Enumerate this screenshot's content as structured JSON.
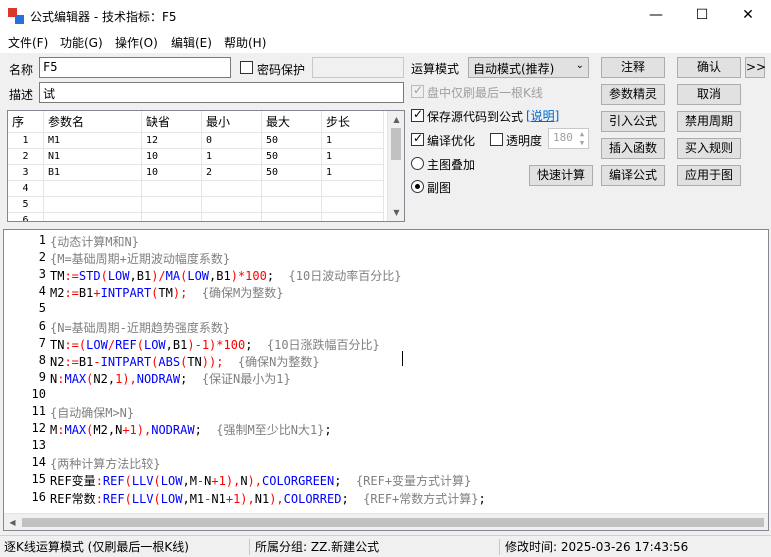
{
  "window": {
    "title": "公式编辑器 - 技术指标：F5",
    "min_glyph": "—",
    "max_glyph": "☐",
    "close_glyph": "✕"
  },
  "menu": [
    "文件(F)",
    "功能(G)",
    "操作(O)",
    "编辑(E)",
    "帮助(H)"
  ],
  "form": {
    "name_label": "名称",
    "name_value": "F5",
    "password_label": "密码保护",
    "desc_label": "描述",
    "desc_value": "试",
    "mode_label": "运算模式",
    "mode_value": "自动模式(推荐)",
    "last_kline_label": "盘中仅刷最后一根K线",
    "save_source_label": "保存源代码到公式",
    "explain_link": "[说明]",
    "compile_opt_label": "编译优化",
    "transparency_label": "透明度",
    "transparency_value": "180",
    "main_overlay_label": "主图叠加",
    "sub_chart_label": "副图"
  },
  "buttons": {
    "annotate": "注释",
    "confirm": "确认",
    "expand": ">>",
    "param_wizard": "参数精灵",
    "cancel": "取消",
    "import_formula": "引入公式",
    "disable_period": "禁用周期",
    "insert_function": "插入函数",
    "buy_rule": "买入规则",
    "quick_calc": "快速计算",
    "compile_formula": "编译公式",
    "apply_chart": "应用于图"
  },
  "param_table": {
    "headers": [
      "序",
      "参数名",
      "缺省",
      "最小",
      "最大",
      "步长"
    ],
    "rows": [
      [
        "1",
        "M1",
        "12",
        "0",
        "50",
        "1"
      ],
      [
        "2",
        "N1",
        "10",
        "1",
        "50",
        "1"
      ],
      [
        "3",
        "B1",
        "10",
        "2",
        "50",
        "1"
      ],
      [
        "4",
        "",
        "",
        "",
        "",
        ""
      ],
      [
        "5",
        "",
        "",
        "",
        "",
        ""
      ],
      [
        "6",
        "",
        "",
        "",
        "",
        ""
      ]
    ]
  },
  "colors": {
    "comment": "#808080",
    "function": "#0000ff",
    "operator": "#ff0000",
    "number": "#ff0000",
    "identifier": "#000000",
    "constant": "#0000ff"
  },
  "code_lines": [
    {
      "n": "1",
      "tokens": [
        {
          "t": "{动态计算M和N}",
          "c": "comment"
        }
      ]
    },
    {
      "n": "2",
      "tokens": [
        {
          "t": "{M=基础周期+近期波动幅度系数}",
          "c": "comment"
        }
      ]
    },
    {
      "n": "3",
      "tokens": [
        {
          "t": "TM",
          "c": "identifier"
        },
        {
          "t": ":=",
          "c": "operator"
        },
        {
          "t": "STD",
          "c": "function"
        },
        {
          "t": "(",
          "c": "operator"
        },
        {
          "t": "LOW",
          "c": "function"
        },
        {
          "t": ",",
          "c": "identifier"
        },
        {
          "t": "B1",
          "c": "identifier"
        },
        {
          "t": ")/",
          "c": "operator"
        },
        {
          "t": "MA",
          "c": "function"
        },
        {
          "t": "(",
          "c": "operator"
        },
        {
          "t": "LOW",
          "c": "function"
        },
        {
          "t": ",",
          "c": "identifier"
        },
        {
          "t": "B1",
          "c": "identifier"
        },
        {
          "t": ")*",
          "c": "operator"
        },
        {
          "t": "100",
          "c": "number"
        },
        {
          "t": ";  ",
          "c": "identifier"
        },
        {
          "t": "{10日波动率百分比}",
          "c": "comment"
        }
      ]
    },
    {
      "n": "4",
      "tokens": [
        {
          "t": "M2",
          "c": "identifier"
        },
        {
          "t": ":=",
          "c": "operator"
        },
        {
          "t": "B1",
          "c": "identifier"
        },
        {
          "t": "+",
          "c": "operator"
        },
        {
          "t": "INTPART",
          "c": "function"
        },
        {
          "t": "(",
          "c": "operator"
        },
        {
          "t": "TM",
          "c": "identifier"
        },
        {
          "t": ");  ",
          "c": "operator"
        },
        {
          "t": "{确保M为整数}",
          "c": "comment"
        }
      ]
    },
    {
      "n": "5",
      "tokens": []
    },
    {
      "n": "6",
      "tokens": [
        {
          "t": "{N=基础周期-近期趋势强度系数}",
          "c": "comment"
        }
      ]
    },
    {
      "n": "7",
      "tokens": [
        {
          "t": "TN",
          "c": "identifier"
        },
        {
          "t": ":=(",
          "c": "operator"
        },
        {
          "t": "LOW",
          "c": "function"
        },
        {
          "t": "/",
          "c": "operator"
        },
        {
          "t": "REF",
          "c": "function"
        },
        {
          "t": "(",
          "c": "operator"
        },
        {
          "t": "LOW",
          "c": "function"
        },
        {
          "t": ",",
          "c": "identifier"
        },
        {
          "t": "B1",
          "c": "identifier"
        },
        {
          "t": ")-",
          "c": "operator"
        },
        {
          "t": "1",
          "c": "number"
        },
        {
          "t": ")*",
          "c": "operator"
        },
        {
          "t": "100",
          "c": "number"
        },
        {
          "t": ";  ",
          "c": "identifier"
        },
        {
          "t": "{10日涨跌幅百分比}",
          "c": "comment"
        }
      ]
    },
    {
      "n": "8",
      "tokens": [
        {
          "t": "N2",
          "c": "identifier"
        },
        {
          "t": ":=",
          "c": "operator"
        },
        {
          "t": "B1",
          "c": "identifier"
        },
        {
          "t": "-",
          "c": "operator"
        },
        {
          "t": "INTPART",
          "c": "function"
        },
        {
          "t": "(",
          "c": "operator"
        },
        {
          "t": "ABS",
          "c": "function"
        },
        {
          "t": "(",
          "c": "operator"
        },
        {
          "t": "TN",
          "c": "identifier"
        },
        {
          "t": "));  ",
          "c": "operator"
        },
        {
          "t": "{确保N为整数}",
          "c": "comment"
        }
      ]
    },
    {
      "n": "9",
      "tokens": [
        {
          "t": "N",
          "c": "identifier"
        },
        {
          "t": ":",
          "c": "operator"
        },
        {
          "t": "MAX",
          "c": "function"
        },
        {
          "t": "(",
          "c": "operator"
        },
        {
          "t": "N2",
          "c": "identifier"
        },
        {
          "t": ",",
          "c": "identifier"
        },
        {
          "t": "1",
          "c": "number"
        },
        {
          "t": "),",
          "c": "operator"
        },
        {
          "t": "NODRAW",
          "c": "constant"
        },
        {
          "t": ";  ",
          "c": "identifier"
        },
        {
          "t": "{保证N最小为1}",
          "c": "comment"
        }
      ]
    },
    {
      "n": "10",
      "tokens": []
    },
    {
      "n": "11",
      "tokens": [
        {
          "t": "{自动确保M>N}",
          "c": "comment"
        }
      ]
    },
    {
      "n": "12",
      "tokens": [
        {
          "t": "M",
          "c": "identifier"
        },
        {
          "t": ":",
          "c": "operator"
        },
        {
          "t": "MAX",
          "c": "function"
        },
        {
          "t": "(",
          "c": "operator"
        },
        {
          "t": "M2",
          "c": "identifier"
        },
        {
          "t": ",",
          "c": "identifier"
        },
        {
          "t": "N",
          "c": "identifier"
        },
        {
          "t": "+",
          "c": "operator"
        },
        {
          "t": "1",
          "c": "number"
        },
        {
          "t": "),",
          "c": "operator"
        },
        {
          "t": "NODRAW",
          "c": "constant"
        },
        {
          "t": ";  ",
          "c": "identifier"
        },
        {
          "t": "{强制M至少比N大1}",
          "c": "comment"
        },
        {
          "t": ";",
          "c": "identifier"
        }
      ]
    },
    {
      "n": "13",
      "tokens": []
    },
    {
      "n": "14",
      "tokens": [
        {
          "t": "{两种计算方法比较}",
          "c": "comment"
        }
      ]
    },
    {
      "n": "15",
      "tokens": [
        {
          "t": "REF变量",
          "c": "identifier"
        },
        {
          "t": ":",
          "c": "operator"
        },
        {
          "t": "REF",
          "c": "function"
        },
        {
          "t": "(",
          "c": "operator"
        },
        {
          "t": "LLV",
          "c": "function"
        },
        {
          "t": "(",
          "c": "operator"
        },
        {
          "t": "LOW",
          "c": "function"
        },
        {
          "t": ",",
          "c": "identifier"
        },
        {
          "t": "M",
          "c": "identifier"
        },
        {
          "t": "-",
          "c": "operator"
        },
        {
          "t": "N",
          "c": "identifier"
        },
        {
          "t": "+",
          "c": "operator"
        },
        {
          "t": "1",
          "c": "number"
        },
        {
          "t": "),",
          "c": "operator"
        },
        {
          "t": "N",
          "c": "identifier"
        },
        {
          "t": "),",
          "c": "operator"
        },
        {
          "t": "COLORGREEN",
          "c": "constant"
        },
        {
          "t": ";  ",
          "c": "identifier"
        },
        {
          "t": "{REF+变量方式计算}",
          "c": "comment"
        }
      ]
    },
    {
      "n": "16",
      "tokens": [
        {
          "t": "REF常数",
          "c": "identifier"
        },
        {
          "t": ":",
          "c": "operator"
        },
        {
          "t": "REF",
          "c": "function"
        },
        {
          "t": "(",
          "c": "operator"
        },
        {
          "t": "LLV",
          "c": "function"
        },
        {
          "t": "(",
          "c": "operator"
        },
        {
          "t": "LOW",
          "c": "function"
        },
        {
          "t": ",",
          "c": "identifier"
        },
        {
          "t": "M1",
          "c": "identifier"
        },
        {
          "t": "-",
          "c": "operator"
        },
        {
          "t": "N1",
          "c": "identifier"
        },
        {
          "t": "+",
          "c": "operator"
        },
        {
          "t": "1",
          "c": "number"
        },
        {
          "t": "),",
          "c": "operator"
        },
        {
          "t": "N1",
          "c": "identifier"
        },
        {
          "t": "),",
          "c": "operator"
        },
        {
          "t": "COLORRED",
          "c": "constant"
        },
        {
          "t": ";  ",
          "c": "identifier"
        },
        {
          "t": "{REF+常数方式计算}",
          "c": "comment"
        },
        {
          "t": ";",
          "c": "identifier"
        }
      ]
    }
  ],
  "status": {
    "mode": "逐K线运算模式 (仅刷最后一根K线)",
    "group": "所属分组: ZZ.新建公式",
    "modified": "修改时间: 2025-03-26 17:43:56"
  }
}
